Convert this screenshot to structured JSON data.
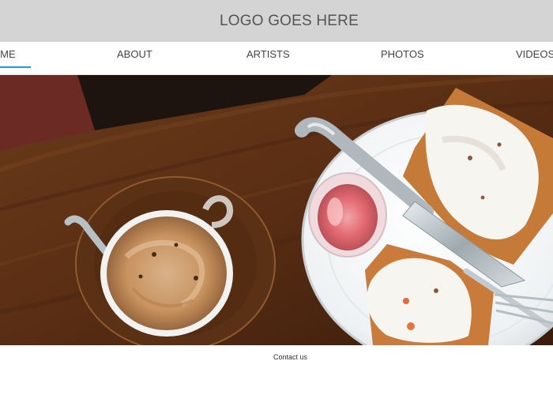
{
  "header": {
    "logo_text": "LOGO GOES HERE"
  },
  "nav": {
    "items": [
      {
        "label": "HOME",
        "display": "OME",
        "active": true
      },
      {
        "label": "ABOUT"
      },
      {
        "label": "ARTISTS"
      },
      {
        "label": "PHOTOS"
      },
      {
        "label": "VIDEOS"
      }
    ],
    "accent_color": "#2196f3"
  },
  "hero": {
    "subject": "coffee-and-waffles-photo"
  },
  "footer": {
    "contact_label": "Contact us"
  }
}
